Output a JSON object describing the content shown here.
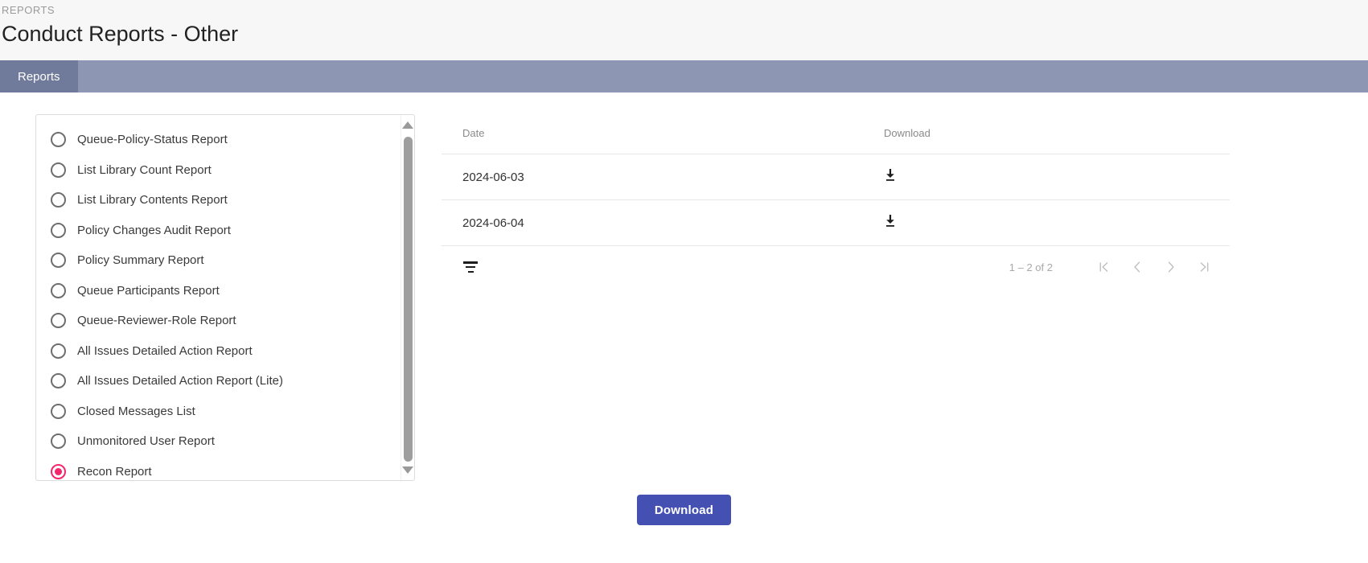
{
  "header": {
    "breadcrumb": "REPORTS",
    "title": "Conduct Reports - Other"
  },
  "tabs": [
    {
      "label": "Reports",
      "active": true
    }
  ],
  "report_list": {
    "items": [
      {
        "label": "Queue-Policy-Status Report",
        "selected": false
      },
      {
        "label": "List Library Count Report",
        "selected": false
      },
      {
        "label": "List Library Contents Report",
        "selected": false
      },
      {
        "label": "Policy Changes Audit Report",
        "selected": false
      },
      {
        "label": "Policy Summary Report",
        "selected": false
      },
      {
        "label": "Queue Participants Report",
        "selected": false
      },
      {
        "label": "Queue-Reviewer-Role Report",
        "selected": false
      },
      {
        "label": "All Issues Detailed Action Report",
        "selected": false
      },
      {
        "label": "All Issues Detailed Action Report (Lite)",
        "selected": false
      },
      {
        "label": "Closed Messages List",
        "selected": false
      },
      {
        "label": "Unmonitored User Report",
        "selected": false
      },
      {
        "label": "Recon Report",
        "selected": true
      }
    ],
    "selected_color": "#f5256b"
  },
  "table": {
    "columns": [
      "Date",
      "Download"
    ],
    "rows": [
      {
        "date": "2024-06-03",
        "download_icon": "download-icon"
      },
      {
        "date": "2024-06-04",
        "download_icon": "download-icon"
      }
    ]
  },
  "paginator": {
    "filter_icon": "filter-list-icon",
    "range_label": "1 – 2 of 2",
    "first_page_icon": "first-page-icon",
    "prev_page_icon": "chevron-left-icon",
    "next_page_icon": "chevron-right-icon",
    "last_page_icon": "last-page-icon"
  },
  "footer": {
    "download_button": "Download",
    "accent_color": "#4550b3"
  },
  "scrollbar": {
    "up_icon": "triangle-up-icon",
    "down_icon": "triangle-down-icon"
  }
}
